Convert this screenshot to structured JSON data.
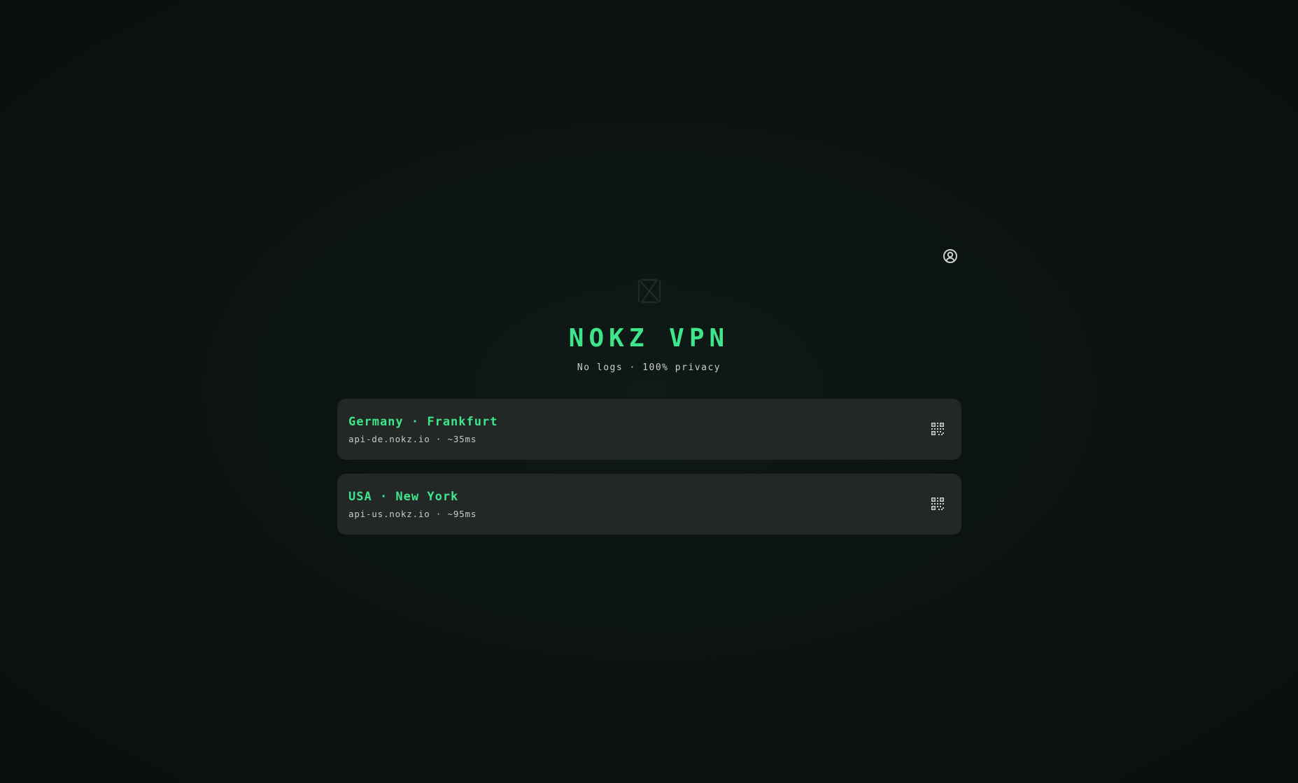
{
  "app": {
    "title": "NOKZ VPN",
    "tagline": "No logs · 100% privacy"
  },
  "header": {
    "profile_icon": "user-circle-icon",
    "logo_icon": "nokz-logo-icon"
  },
  "servers": [
    {
      "name": "Germany · Frankfurt",
      "meta": "api-de.nokz.io · ~35ms",
      "action_icon": "qr-code-icon"
    },
    {
      "name": "USA · New York",
      "meta": "api-us.nokz.io · ~95ms",
      "action_icon": "qr-code-icon"
    }
  ],
  "colors": {
    "background": "#0b1210",
    "accent": "#3ee58b",
    "card": "#232725",
    "text_muted": "#c6ccc9"
  }
}
